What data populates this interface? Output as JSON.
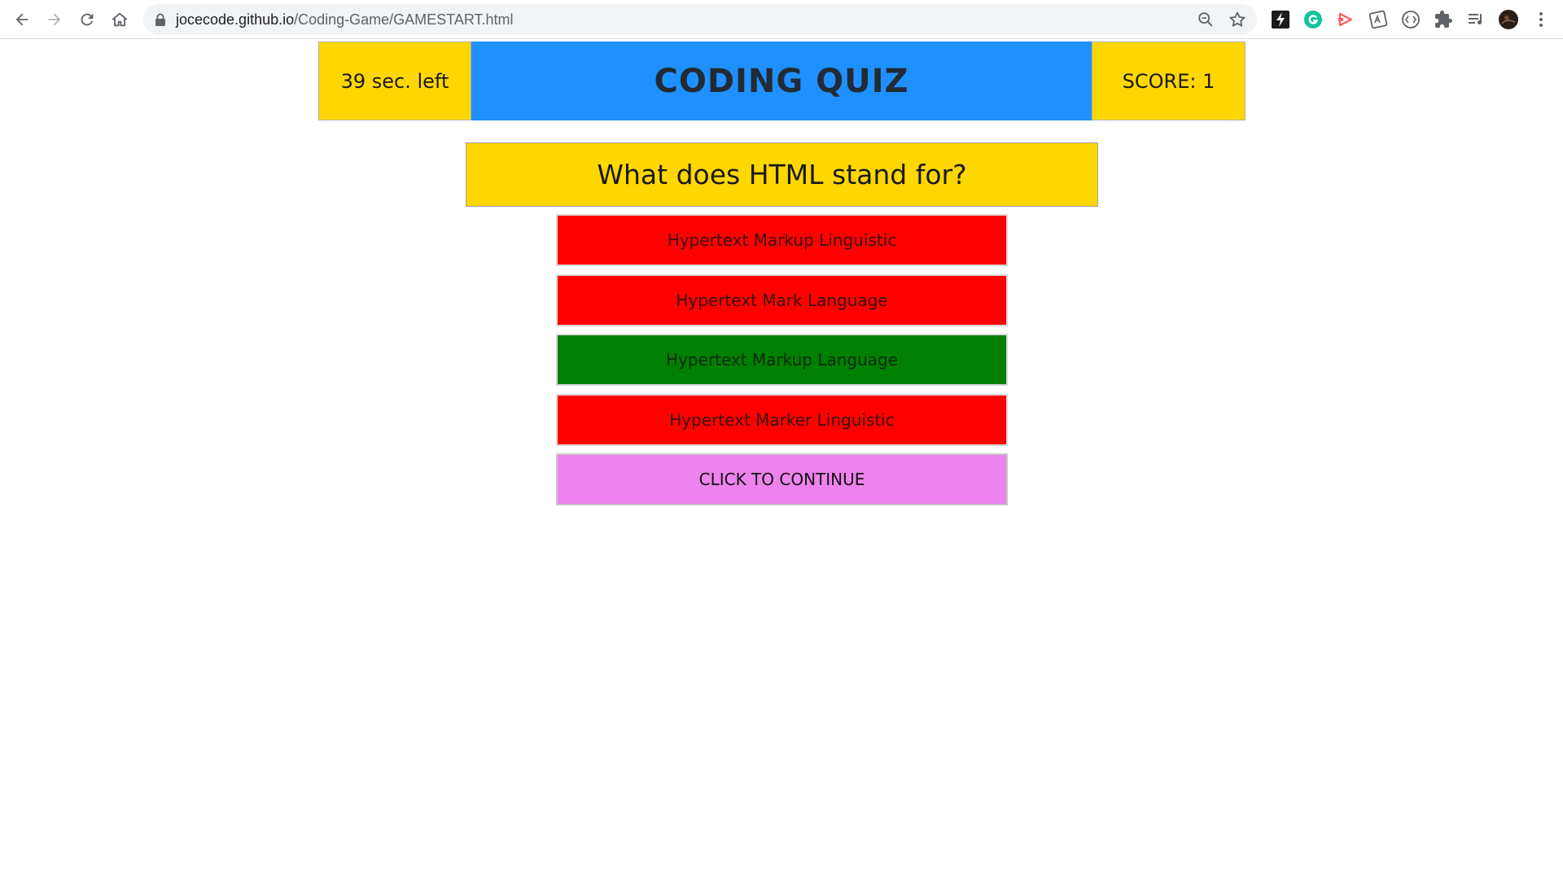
{
  "browser": {
    "url_host": "jocecode.github.io",
    "url_path": "/Coding-Game/GAMESTART.html"
  },
  "header": {
    "timer_text": "39 sec. left",
    "title": "CODING QUIZ",
    "score_text": "SCORE: 1"
  },
  "question": {
    "text": "What does HTML stand for?"
  },
  "answers": [
    {
      "label": "Hypertext Markup Linguistic",
      "state": "wrong",
      "color": "#ff0000"
    },
    {
      "label": "Hypertext Mark Language",
      "state": "wrong",
      "color": "#ff0000"
    },
    {
      "label": "Hypertext Markup Language",
      "state": "correct",
      "color": "#008000"
    },
    {
      "label": "Hypertext Marker Linguistic",
      "state": "wrong",
      "color": "#ff0000"
    }
  ],
  "continue_button": {
    "label": "CLICK TO CONTINUE",
    "color": "#ee82ee"
  },
  "colors": {
    "title_bg": "#1e90ff",
    "yellow": "#ffd700"
  }
}
